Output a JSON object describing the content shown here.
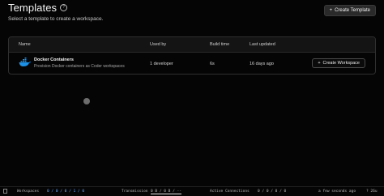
{
  "header": {
    "title": "Templates",
    "help_icon": "?",
    "subtitle": "Select a template to create a workspace.",
    "create_template_label": "Create Template",
    "create_template_icon": "+"
  },
  "table": {
    "columns": [
      "Name",
      "Used by",
      "Build time",
      "Last updated"
    ],
    "rows": [
      {
        "name": "Docker Containers",
        "description": "Provision Docker containers as Coder workspaces",
        "used_by": "1 developer",
        "build_time": "6s",
        "last_updated": "16 days ago",
        "action_label": "Create Workspace",
        "action_icon": "+",
        "icon": "docker-icon"
      }
    ]
  },
  "statusbar": {
    "workspaces_label": "Workspaces",
    "workspace_counts": "0 / 0 / 0 / 1 / 0",
    "transmission_label": "Transmission",
    "transmission_values": "0 B / 0 B / --",
    "active_connections_label": "Active Connections",
    "connection_counts": "0 / 0 / 0 / 0",
    "updated": "a few seconds ago",
    "tail": "? 26u"
  },
  "colors": {
    "background": "#050505",
    "docker_blue": "#1d91e6",
    "status_blue": "#6aa9ff"
  }
}
